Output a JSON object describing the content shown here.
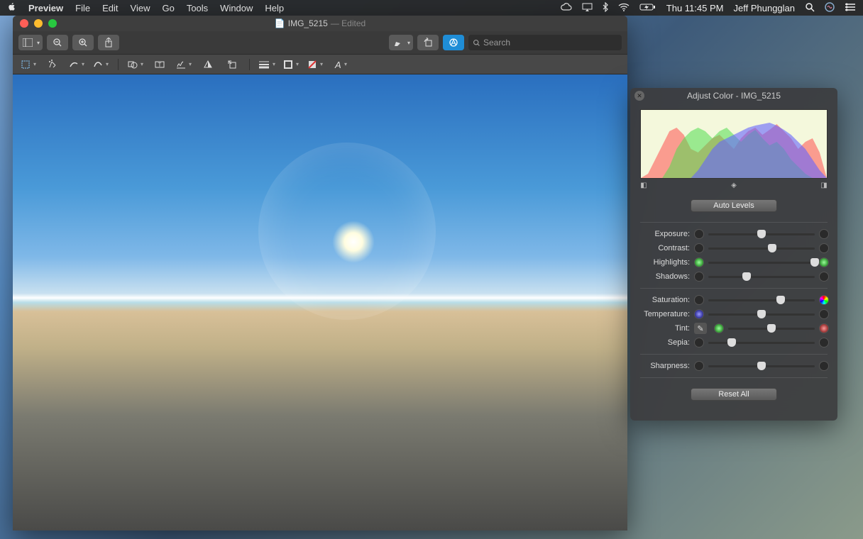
{
  "menubar": {
    "app": "Preview",
    "items": [
      "File",
      "Edit",
      "View",
      "Go",
      "Tools",
      "Window",
      "Help"
    ],
    "clock": "Thu 11:45 PM",
    "user": "Jeff Phungglan"
  },
  "window": {
    "title": "IMG_5215",
    "title_suffix": "— Edited",
    "search_placeholder": "Search"
  },
  "adjust": {
    "title": "Adjust Color - IMG_5215",
    "auto_levels": "Auto Levels",
    "reset_all": "Reset All",
    "sliders": [
      {
        "label": "Exposure:",
        "pos": 50,
        "icon_l": "",
        "icon_r": ""
      },
      {
        "label": "Contrast:",
        "pos": 60,
        "icon_l": "",
        "icon_r": ""
      },
      {
        "label": "Highlights:",
        "pos": 100,
        "icon_l": "g",
        "icon_r": "g"
      },
      {
        "label": "Shadows:",
        "pos": 36,
        "icon_l": "",
        "icon_r": ""
      }
    ],
    "sliders2": [
      {
        "label": "Saturation:",
        "pos": 68,
        "icon_l": "",
        "icon_r": "rainbow"
      },
      {
        "label": "Temperature:",
        "pos": 50,
        "icon_l": "b",
        "icon_r": ""
      },
      {
        "label": "Tint:",
        "pos": 50,
        "icon_l": "g",
        "icon_r": "r",
        "picker": true
      },
      {
        "label": "Sepia:",
        "pos": 22,
        "icon_l": "",
        "icon_r": ""
      }
    ],
    "sliders3": [
      {
        "label": "Sharpness:",
        "pos": 50,
        "icon_l": "",
        "icon_r": ""
      }
    ]
  }
}
